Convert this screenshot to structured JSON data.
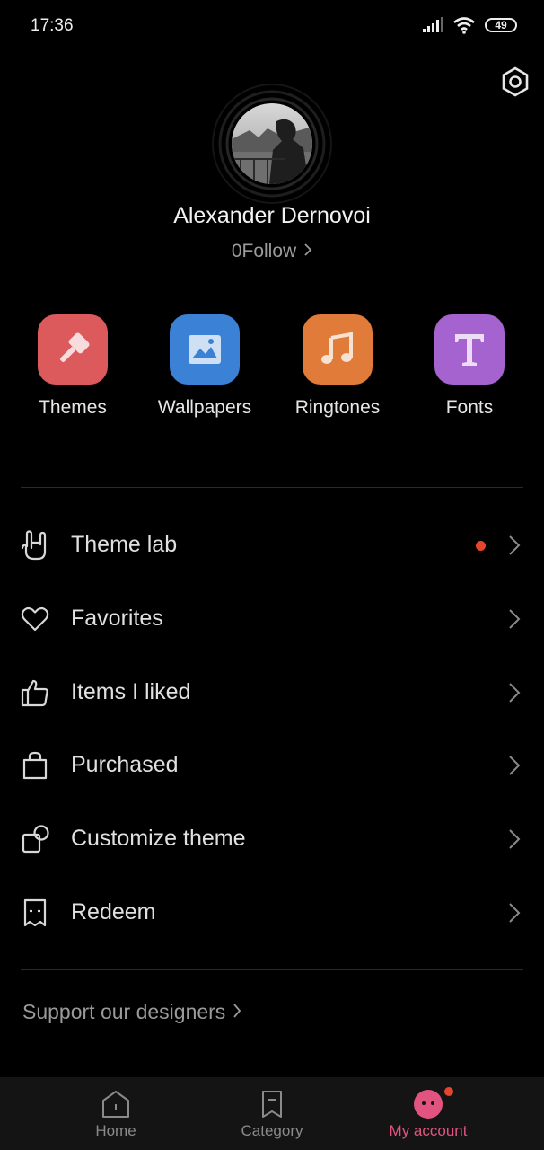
{
  "status_bar": {
    "time": "17:36",
    "battery": "49"
  },
  "profile": {
    "name": "Alexander Dernovoi",
    "follow": "0Follow"
  },
  "categories": [
    {
      "label": "Themes",
      "color": "#dc5a5c",
      "icon": "paint-brush-icon"
    },
    {
      "label": "Wallpapers",
      "color": "#3b82d6",
      "icon": "image-icon"
    },
    {
      "label": "Ringtones",
      "color": "#e07b3a",
      "icon": "music-note-icon"
    },
    {
      "label": "Fonts",
      "color": "#a563cf",
      "icon": "font-t-icon"
    }
  ],
  "menu": [
    {
      "label": "Theme lab",
      "icon": "hand-rock-icon",
      "has_dot": true
    },
    {
      "label": "Favorites",
      "icon": "heart-icon"
    },
    {
      "label": "Items I liked",
      "icon": "thumbs-up-icon"
    },
    {
      "label": "Purchased",
      "icon": "shopping-bag-icon"
    },
    {
      "label": "Customize theme",
      "icon": "customize-shapes-icon"
    },
    {
      "label": "Redeem",
      "icon": "coupon-icon"
    }
  ],
  "support": {
    "label": "Support our designers"
  },
  "bottom_nav": [
    {
      "label": "Home",
      "icon": "home-icon"
    },
    {
      "label": "Category",
      "icon": "bookmark-icon"
    },
    {
      "label": "My account",
      "icon": "account-face-icon",
      "active": true
    }
  ],
  "colors": {
    "accent": "#e0547f",
    "notification_dot": "#e5452d",
    "background": "#000000"
  }
}
